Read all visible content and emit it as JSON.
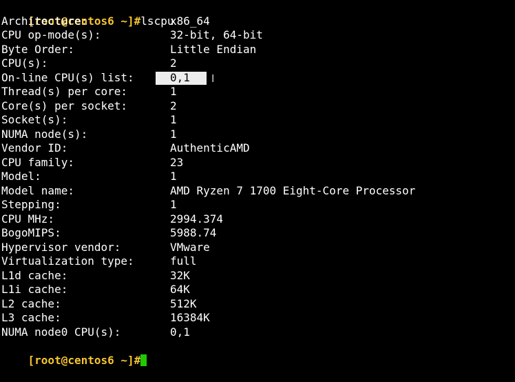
{
  "terminal": {
    "prompt": "[root@centos6 ~]#",
    "command": "lscpu",
    "rows": [
      {
        "key": "Architecture:",
        "value": "x86_64"
      },
      {
        "key": "CPU op-mode(s):",
        "value": "32-bit, 64-bit"
      },
      {
        "key": "Byte Order:",
        "value": "Little Endian"
      },
      {
        "key": "CPU(s):",
        "value": "2"
      },
      {
        "key": "On-line CPU(s) list:",
        "value": "0,1",
        "selected": true
      },
      {
        "key": "Thread(s) per core:",
        "value": "1"
      },
      {
        "key": "Core(s) per socket:",
        "value": "2"
      },
      {
        "key": "Socket(s):",
        "value": "1"
      },
      {
        "key": "NUMA node(s):",
        "value": "1"
      },
      {
        "key": "Vendor ID:",
        "value": "AuthenticAMD"
      },
      {
        "key": "CPU family:",
        "value": "23"
      },
      {
        "key": "Model:",
        "value": "1"
      },
      {
        "key": "Model name:",
        "value": "AMD Ryzen 7 1700 Eight-Core Processor"
      },
      {
        "key": "Stepping:",
        "value": "1"
      },
      {
        "key": "CPU MHz:",
        "value": "2994.374"
      },
      {
        "key": "BogoMIPS:",
        "value": "5988.74"
      },
      {
        "key": "Hypervisor vendor:",
        "value": "VMware"
      },
      {
        "key": "Virtualization type:",
        "value": "full"
      },
      {
        "key": "L1d cache:",
        "value": "32K"
      },
      {
        "key": "L1i cache:",
        "value": "64K"
      },
      {
        "key": "L2 cache:",
        "value": "512K"
      },
      {
        "key": "L3 cache:",
        "value": "16384K"
      },
      {
        "key": "NUMA node0 CPU(s):",
        "value": "0,1"
      }
    ],
    "final_prompt": "[root@centos6 ~]#"
  },
  "colors": {
    "background": "#000000",
    "text": "#ffffff",
    "prompt": "#f5c431",
    "cursor": "#22c900",
    "selection": "#ededed"
  },
  "icons": {
    "mouse_pointer": "text-ibeam-cursor-icon"
  }
}
